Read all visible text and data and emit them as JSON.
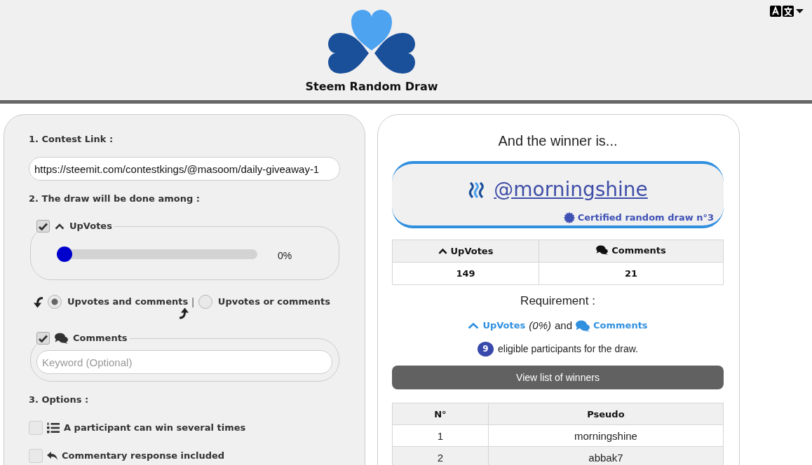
{
  "header": {
    "title": "Steem Random Draw"
  },
  "settings": {
    "contest_link": {
      "label": "1. Contest Link :",
      "value": "https://steemit.com/contestkings/@masoom/daily-giveaway-1"
    },
    "participants": {
      "label": "2. The draw will be done among :",
      "upvotes": {
        "label": "UpVotes",
        "checked": true,
        "level": 0,
        "reading": "0%"
      },
      "combine_options": [
        {
          "label": "Upvotes and comments",
          "selected": true
        },
        {
          "label": "Upvotes or comments",
          "selected": false
        }
      ],
      "separator": "|",
      "comments": {
        "label": "Comments",
        "checked": true,
        "placeholder": "Keyword (Optional)"
      }
    },
    "options": {
      "label": "3. Options :",
      "items": [
        {
          "kind": "list",
          "label": "A participant can win several times",
          "checked": false
        },
        {
          "kind": "reply",
          "label": "Commentary response included",
          "checked": false
        }
      ]
    }
  },
  "result": {
    "heading": "And the winner is...",
    "winner": {
      "name": "@morningshine",
      "certificate": "Certified random draw n°3"
    },
    "stats": {
      "columns": [
        {
          "kind": "upvotes",
          "label": "UpVotes"
        },
        {
          "kind": "comments",
          "label": "Comments"
        }
      ],
      "values": [
        "149",
        "21"
      ]
    },
    "requirement": {
      "heading": "Requirement :",
      "upvotes": "UpVotes",
      "upvotes_share": "(0%)",
      "conjunction": "and",
      "comments": "Comments"
    },
    "eligible": {
      "count": "9",
      "text": "eligible participants for the draw."
    },
    "view_winners_button": "View list of winners",
    "winners_table": {
      "columns": [
        "N°",
        "Pseudo"
      ],
      "rows": [
        [
          "1",
          "morningshine"
        ],
        [
          "2",
          "abbak7"
        ]
      ]
    }
  }
}
